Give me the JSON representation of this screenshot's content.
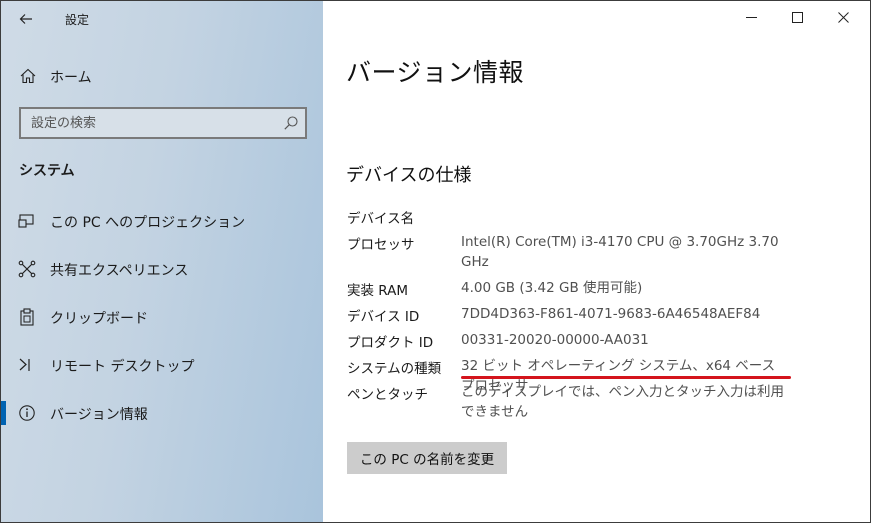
{
  "window": {
    "app_title": "設定",
    "controls": [
      "minimize",
      "maximize",
      "close"
    ]
  },
  "sidebar": {
    "home_label": "ホーム",
    "search_placeholder": "設定の検索",
    "section_title": "システム",
    "items": [
      {
        "label": "この PC へのプロジェクション",
        "icon": "projection-icon",
        "selected": false
      },
      {
        "label": "共有エクスペリエンス",
        "icon": "shared-experience-icon",
        "selected": false
      },
      {
        "label": "クリップボード",
        "icon": "clipboard-icon",
        "selected": false
      },
      {
        "label": "リモート デスクトップ",
        "icon": "remote-desktop-icon",
        "selected": false
      },
      {
        "label": "バージョン情報",
        "icon": "info-icon",
        "selected": true
      }
    ]
  },
  "main": {
    "title": "バージョン情報",
    "device_spec_title": "デバイスの仕様",
    "specs": [
      {
        "label": "デバイス名",
        "value": ""
      },
      {
        "label": "プロセッサ",
        "value": "Intel(R) Core(TM) i3-4170 CPU @ 3.70GHz   3.70 GHz"
      },
      {
        "label": "実装 RAM",
        "value": "4.00 GB (3.42 GB 使用可能)"
      },
      {
        "label": "デバイス ID",
        "value": "7DD4D363-F861-4071-9683-6A46548AEF84"
      },
      {
        "label": "プロダクト ID",
        "value": "00331-20020-00000-AA031"
      },
      {
        "label": "システムの種類",
        "value": "32 ビット オペレーティング システム、x64 ベース プロセッサ"
      },
      {
        "label": "ペンとタッチ",
        "value": "このディスプレイでは、ペン入力とタッチ入力は利用できません"
      }
    ],
    "rename_button": "この PC の名前を変更"
  },
  "colors": {
    "accent": "#0063b1",
    "highlight_underline": "#d4141c",
    "button_bg": "#cccccc"
  }
}
